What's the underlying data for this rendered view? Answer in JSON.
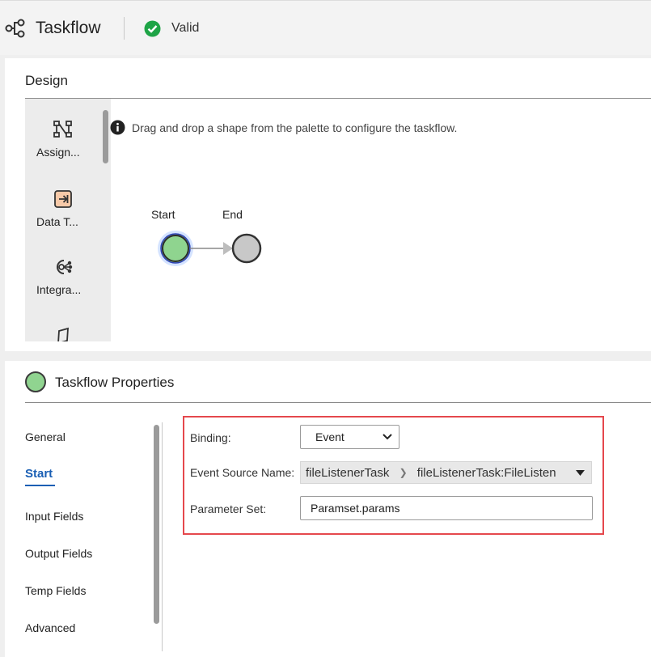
{
  "header": {
    "title": "Taskflow",
    "status": "Valid",
    "status_color": "#1ea446",
    "app_icon": "taskflow-nodes-icon",
    "status_icon": "check-circle-icon"
  },
  "design": {
    "heading": "Design",
    "palette": [
      {
        "label": "Assign...",
        "icon": "assignment-icon"
      },
      {
        "label": "Data T...",
        "icon": "data-task-icon"
      },
      {
        "label": "Integra...",
        "icon": "integration-icon"
      },
      {
        "label": "",
        "icon": "parallelogram-icon"
      }
    ],
    "hint": "Drag and drop a shape from the palette to configure the taskflow.",
    "hint_icon": "info-icon",
    "start_label": "Start",
    "end_label": "End"
  },
  "properties": {
    "heading": "Taskflow Properties",
    "tabs": [
      "General",
      "Start",
      "Input Fields",
      "Output Fields",
      "Temp Fields",
      "Advanced"
    ],
    "active_tab": "Start",
    "binding_label": "Binding:",
    "binding_value": "Event",
    "event_source_label": "Event Source Name:",
    "event_source_part1": "fileListenerTask",
    "event_source_part2": "fileListenerTask:FileListen",
    "parameter_set_label": "Parameter Set:",
    "parameter_set_value": "Paramset.params",
    "highlight_color": "#e5484d"
  }
}
